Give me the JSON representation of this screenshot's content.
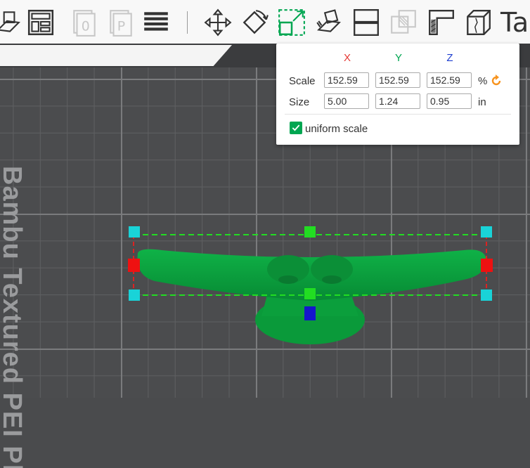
{
  "toolbar": {
    "tools": [
      {
        "name": "add-plate-icon"
      },
      {
        "name": "arrange-icon"
      },
      {
        "name": "orient-icon"
      },
      {
        "name": "auto-orient-icon"
      },
      {
        "name": "layers-icon"
      },
      {
        "name": "move-icon"
      },
      {
        "name": "rotate-icon"
      },
      {
        "name": "scale-icon"
      },
      {
        "name": "lay-on-face-icon"
      },
      {
        "name": "cut-icon"
      },
      {
        "name": "mesh-boolean-icon"
      },
      {
        "name": "support-paint-icon"
      },
      {
        "name": "seam-paint-icon"
      },
      {
        "name": "text-icon"
      }
    ],
    "text_tool_label": "Ta"
  },
  "plate": {
    "label": "Bambu Textured PEI Plate"
  },
  "scale_panel": {
    "axis_x": "X",
    "axis_y": "Y",
    "axis_z": "Z",
    "scale_label": "Scale",
    "size_label": "Size",
    "scale_x": "152.59",
    "scale_y": "152.59",
    "scale_z": "152.59",
    "size_x": "5.00",
    "size_y": "1.24",
    "size_z": "0.95",
    "scale_unit": "%",
    "size_unit": "in",
    "uniform_label": "uniform scale",
    "uniform_checked": true,
    "colors": {
      "x": "#e53935",
      "y": "#00a651",
      "z": "#1f3fd0",
      "accent": "#f7931e"
    }
  }
}
